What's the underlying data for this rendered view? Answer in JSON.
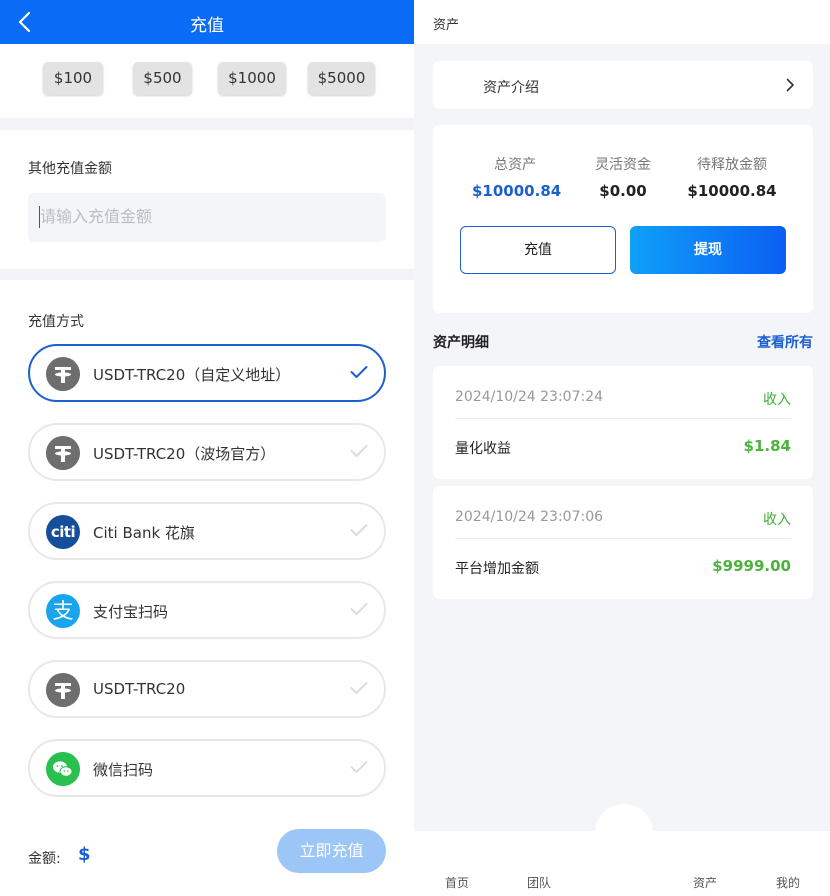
{
  "recharge": {
    "title": "充值",
    "quick_amounts": [
      "$100",
      "$500",
      "$1000",
      "$5000"
    ],
    "other_amount_label": "其他充值金额",
    "amount_placeholder": "请输入充值金额",
    "method_section_label": "充值方式",
    "methods": [
      {
        "label": "USDT-TRC20（自定义地址）",
        "icon": "tether-icon",
        "selected": true
      },
      {
        "label": "USDT-TRC20（波场官方）",
        "icon": "tether-icon",
        "selected": false
      },
      {
        "label": "Citi Bank 花旗",
        "icon": "citi-icon",
        "icon_text": "citi",
        "selected": false
      },
      {
        "label": "支付宝扫码",
        "icon": "alipay-icon",
        "icon_text": "支",
        "selected": false
      },
      {
        "label": "USDT-TRC20",
        "icon": "tether-icon",
        "selected": false
      },
      {
        "label": "微信扫码",
        "icon": "wechat-icon",
        "selected": false
      }
    ],
    "amount_label": "金额:",
    "currency_symbol": "$",
    "submit_label": "立即充值"
  },
  "assets": {
    "title": "资产",
    "intro_label": "资产介绍",
    "stats": [
      {
        "label": "总资产",
        "value": "$10000.84"
      },
      {
        "label": "灵活资金",
        "value": "$0.00"
      },
      {
        "label": "待释放金额",
        "value": "$10000.84"
      }
    ],
    "recharge_button": "充值",
    "withdraw_button": "提现",
    "detail_title": "资产明细",
    "view_all": "查看所有",
    "records": [
      {
        "date": "2024/10/24 23:07:24",
        "type": "收入",
        "name": "量化收益",
        "amount": "$1.84"
      },
      {
        "date": "2024/10/24 23:07:06",
        "type": "收入",
        "name": "平台增加金额",
        "amount": "$9999.00"
      }
    ],
    "tabs": [
      "首页",
      "团队",
      "资产",
      "我的"
    ]
  },
  "colors": {
    "primary": "#0a6cf5",
    "accent_blue": "#1b5fd1",
    "income_green": "#4bb33c",
    "submit_disabled": "#9cc6f6"
  }
}
